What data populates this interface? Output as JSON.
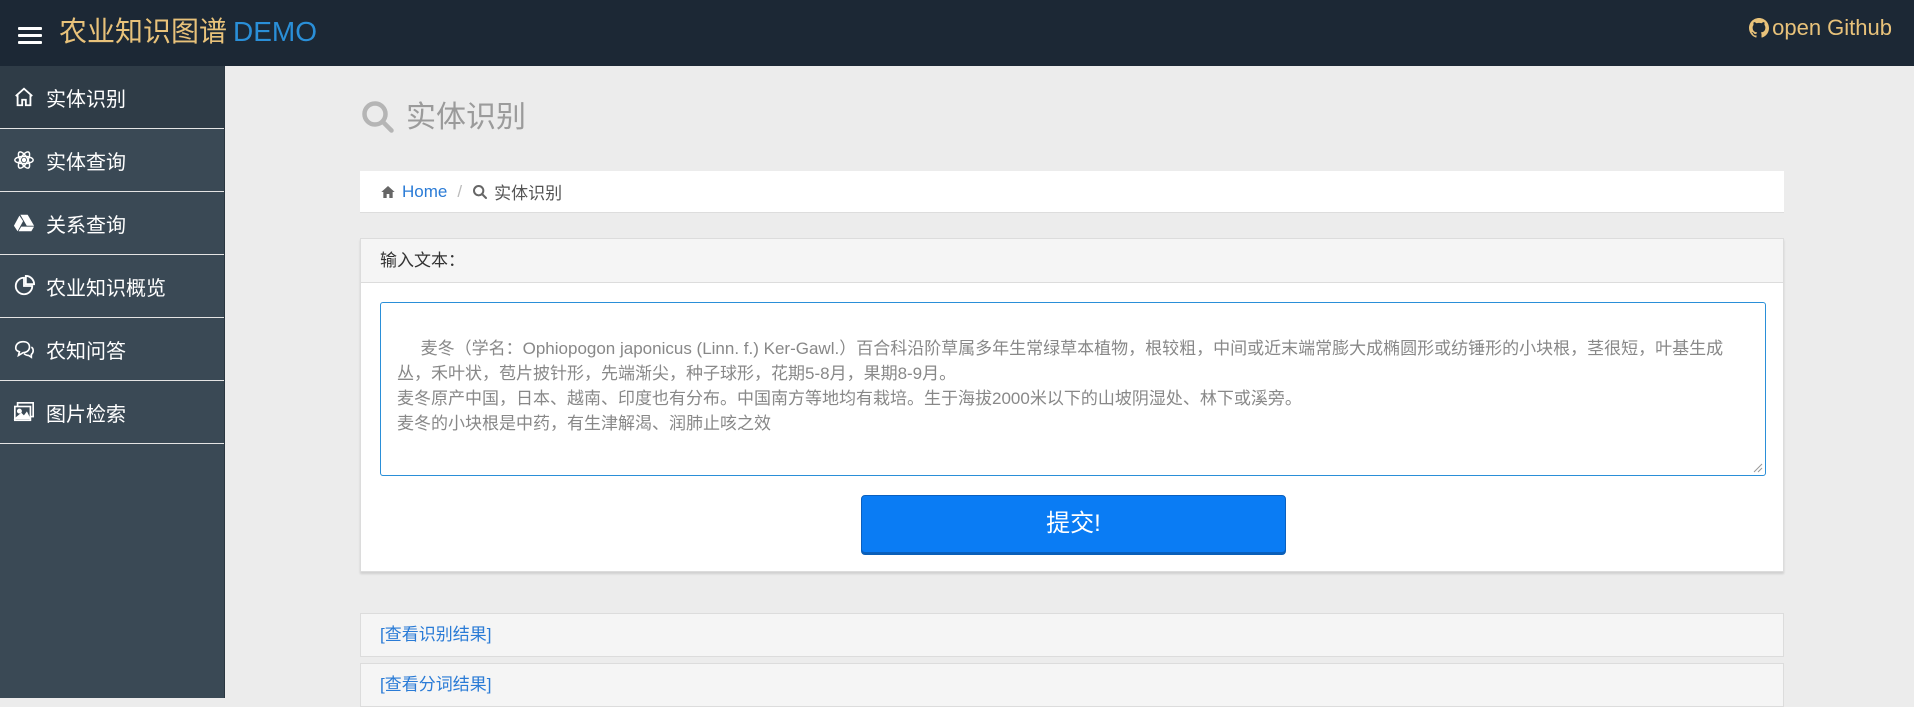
{
  "header": {
    "brand_name": "农业知识图谱",
    "brand_tag": "DEMO",
    "github_label": "open Github"
  },
  "sidebar": {
    "items": [
      {
        "label": "实体识别",
        "icon": "home-icon"
      },
      {
        "label": "实体查询",
        "icon": "atom-icon"
      },
      {
        "label": "关系查询",
        "icon": "drive-icon"
      },
      {
        "label": "农业知识概览",
        "icon": "pie-chart-icon"
      },
      {
        "label": "农知问答",
        "icon": "chat-icon"
      },
      {
        "label": "图片检索",
        "icon": "image-icon"
      }
    ]
  },
  "main": {
    "page_title": "实体识别",
    "breadcrumb": {
      "home": "Home",
      "current": "实体识别"
    },
    "input_label": "输入文本：",
    "input_text": " 麦冬（学名：Ophiopogon japonicus (Linn. f.) Ker-Gawl.）百合科沿阶草属多年生常绿草本植物，根较粗，中间或近末端常膨大成椭圆形或纺锤形的小块根，茎很短，叶基生成丛，禾叶状，苞片披针形，先端渐尖，种子球形，花期5-8月，果期8-9月。\n麦冬原产中国，日本、越南、印度也有分布。中国南方等地均有栽培。生于海拔2000米以下的山坡阴湿处、林下或溪旁。\n麦冬的小块根是中药，有生津解渴、润肺止咳之效",
    "submit_label": "提交!",
    "results": [
      "[查看识别结果]",
      "[查看分词结果]"
    ]
  },
  "colors": {
    "topbar_bg": "#1c2835",
    "sidebar_bg": "#3a4955",
    "brand_color": "#e8c27a",
    "accent_blue": "#0a7cf4"
  }
}
